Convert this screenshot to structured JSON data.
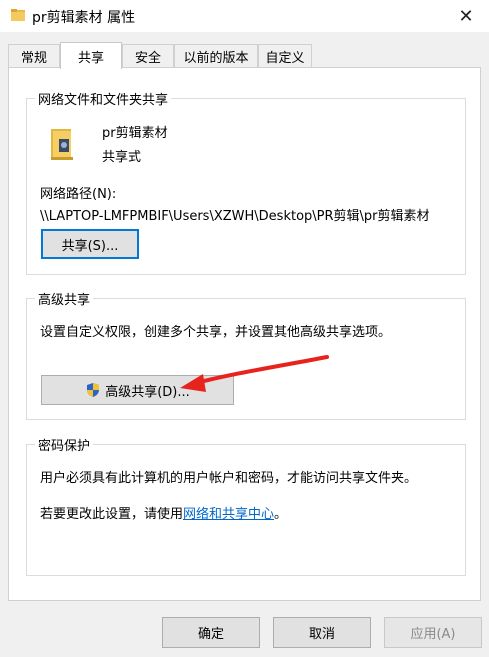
{
  "window": {
    "title": "pr剪辑素材 属性",
    "close_glyph": "✕"
  },
  "tabs": [
    {
      "label": "常规"
    },
    {
      "label": "共享"
    },
    {
      "label": "安全"
    },
    {
      "label": "以前的版本"
    },
    {
      "label": "自定义"
    }
  ],
  "network_sharing": {
    "group_title": "网络文件和文件夹共享",
    "folder_name": "pr剪辑素材",
    "share_status": "共享式",
    "path_label": "网络路径(N):",
    "path_value": "\\\\LAPTOP-LMFPMBIF\\Users\\XZWH\\Desktop\\PR剪辑\\pr剪辑素材",
    "share_button": "共享(S)..."
  },
  "advanced_sharing": {
    "group_title": "高级共享",
    "description": "设置自定义权限，创建多个共享，并设置其他高级共享选项。",
    "button": "高级共享(D)..."
  },
  "password_protection": {
    "group_title": "密码保护",
    "description": "用户必须具有此计算机的用户帐户和密码，才能访问共享文件夹。",
    "change_prefix": "若要更改此设置，请使用",
    "link_text": "网络和共享中心",
    "change_suffix": "。"
  },
  "footer": {
    "ok": "确定",
    "cancel": "取消",
    "apply": "应用(A)"
  },
  "colors": {
    "accent": "#0078d7",
    "link": "#0066cc",
    "annotation_arrow": "#e8231e"
  }
}
